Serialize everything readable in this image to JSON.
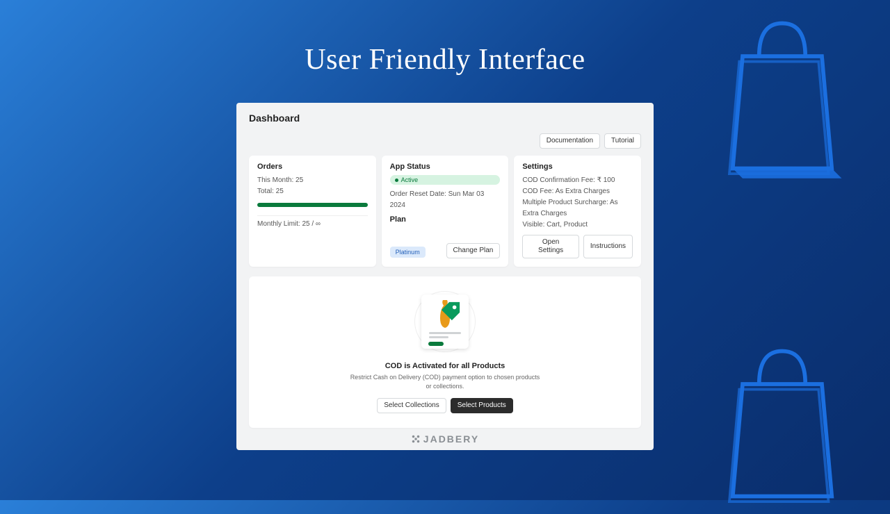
{
  "hero": {
    "title": "User Friendly Interface"
  },
  "window": {
    "title": "Dashboard",
    "top_buttons": {
      "documentation": "Documentation",
      "tutorial": "Tutorial"
    }
  },
  "orders_card": {
    "heading": "Orders",
    "this_month": "This Month: 25",
    "total": "Total: 25",
    "limit_text": "Monthly Limit: 25 / ∞"
  },
  "status_card": {
    "heading": "App Status",
    "status_label": "Active",
    "reset_date": "Order Reset Date: Sun Mar 03 2024",
    "plan_heading": "Plan",
    "plan_name": "Platinum",
    "change_plan_btn": "Change Plan"
  },
  "settings_card": {
    "heading": "Settings",
    "line1": "COD Confirmation Fee: ₹ 100",
    "line2": "COD Fee: As Extra Charges",
    "line3": "Multiple Product Surcharge: As Extra Charges",
    "line4": "Visible: Cart, Product",
    "open_btn": "Open Settings",
    "instructions_btn": "Instructions"
  },
  "main_panel": {
    "title": "COD is Activated for all Products",
    "subtitle": "Restrict Cash on Delivery (COD) payment option to chosen products or collections.",
    "select_collections_btn": "Select Collections",
    "select_products_btn": "Select Products"
  },
  "footer": {
    "brand": "JADBERY"
  }
}
